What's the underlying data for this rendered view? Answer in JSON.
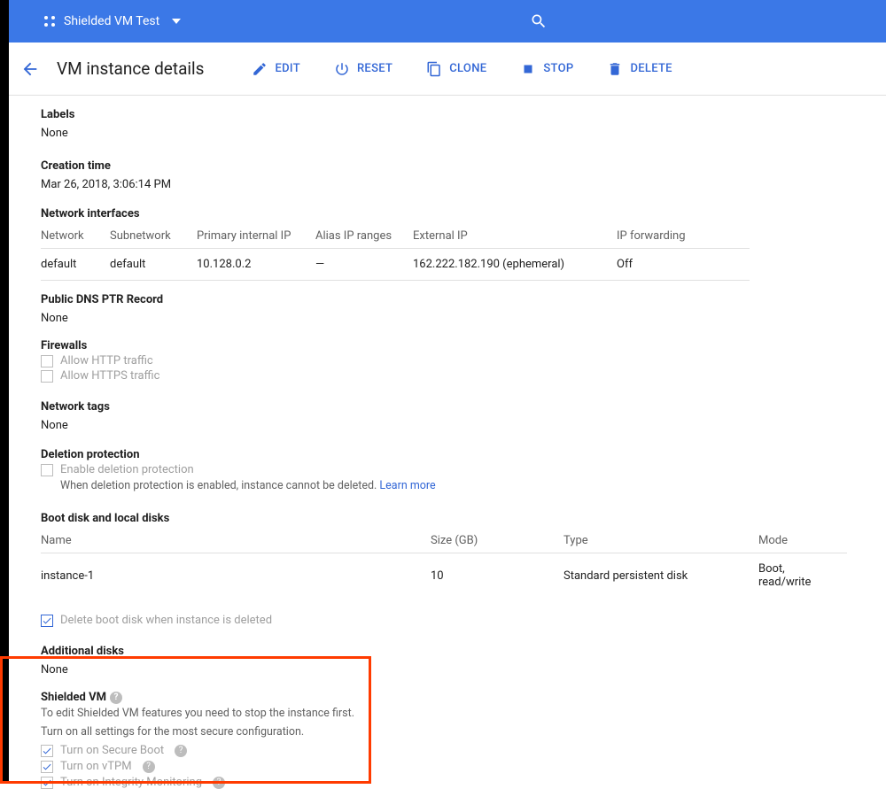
{
  "topbar": {
    "project_name": "Shielded VM Test"
  },
  "page": {
    "title": "VM instance details"
  },
  "actions": {
    "edit": "EDIT",
    "reset": "RESET",
    "clone": "CLONE",
    "stop": "STOP",
    "delete": "DELETE"
  },
  "labels": {
    "header": "Labels",
    "value": "None"
  },
  "creation": {
    "header": "Creation time",
    "value": "Mar 26, 2018, 3:06:14 PM"
  },
  "network_interfaces": {
    "header": "Network interfaces",
    "columns": {
      "network": "Network",
      "subnetwork": "Subnetwork",
      "primary_internal_ip": "Primary internal IP",
      "alias_ip_ranges": "Alias IP ranges",
      "external_ip": "External IP",
      "ip_forwarding": "IP forwarding"
    },
    "row": {
      "network": "default",
      "subnetwork": "default",
      "primary_internal_ip": "10.128.0.2",
      "alias_ip_ranges": "—",
      "external_ip": "162.222.182.190 (ephemeral)",
      "ip_forwarding": "Off"
    }
  },
  "public_dns": {
    "header": "Public DNS PTR Record",
    "value": "None"
  },
  "firewalls": {
    "header": "Firewalls",
    "http": "Allow HTTP traffic",
    "https": "Allow HTTPS traffic"
  },
  "network_tags": {
    "header": "Network tags",
    "value": "None"
  },
  "deletion_protection": {
    "header": "Deletion protection",
    "checkbox_label": "Enable deletion protection",
    "help": "When deletion protection is enabled, instance cannot be deleted.",
    "learn_more": "Learn more"
  },
  "boot_disks": {
    "header": "Boot disk and local disks",
    "columns": {
      "name": "Name",
      "size": "Size (GB)",
      "type": "Type",
      "mode": "Mode"
    },
    "row": {
      "name": "instance-1",
      "size": "10",
      "type": "Standard persistent disk",
      "mode": "Boot, read/write"
    },
    "delete_boot_label": "Delete boot disk when instance is deleted"
  },
  "additional_disks": {
    "header": "Additional disks",
    "value": "None"
  },
  "shielded_vm": {
    "header": "Shielded VM",
    "desc1": "To edit Shielded VM features you need to stop the instance first.",
    "desc2": "Turn on all settings for the most secure configuration.",
    "secure_boot": "Turn on Secure Boot",
    "vtpm": "Turn on vTPM",
    "integrity": "Turn on Integrity Monitoring"
  }
}
